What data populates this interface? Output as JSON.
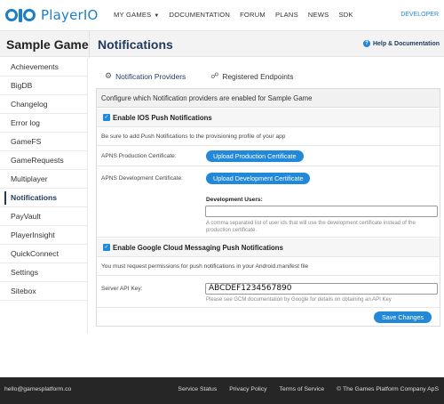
{
  "brand": {
    "name": "PlayerIO"
  },
  "nav": {
    "links": [
      "MY GAMES",
      "DOCUMENTATION",
      "FORUM",
      "PLANS",
      "NEWS",
      "SDK"
    ],
    "developer": "DEVELOPER"
  },
  "header": {
    "game_title": "Sample Game",
    "page_title": "Notifications",
    "help": "Help & Documentation"
  },
  "sidebar": {
    "items": [
      "Achievements",
      "BigDB",
      "Changelog",
      "Error log",
      "GameFS",
      "GameRequests",
      "Multiplayer",
      "Notifications",
      "PayVault",
      "PlayerInsight",
      "QuickConnect",
      "Settings",
      "Sitebox"
    ],
    "active": "Notifications"
  },
  "tabs": {
    "providers": "Notification Providers",
    "endpoints": "Registered Endpoints"
  },
  "panel": {
    "heading": "Configure which Notification providers are enabled for Sample Game",
    "ios": {
      "checkbox_label": "Enable IOS Push Notifications",
      "note": "Be sure to add Push Notifications to the provisioning profile of your app",
      "prod_label": "APNS Production Certificate:",
      "prod_button": "Upload Production Certificate",
      "dev_label": "APNS Development Certificate:",
      "dev_button": "Upload Development Certificate",
      "dev_users_label": "Development Users:",
      "dev_users_value": "",
      "dev_users_help": "A comma separated list of user ids that will use the development certificate instead of the production certificate."
    },
    "gcm": {
      "checkbox_label": "Enable Google Cloud Messaging Push Notifications",
      "note": "You must request permissions for push notifications in your Android.manifest file",
      "api_key_label": "Server API Key:",
      "api_key_value": "ABCDEF1234567890",
      "api_key_help": "Please see GCM documentation by Google for details on obtaining an API Key"
    },
    "save": "Save Changes"
  },
  "footer": {
    "email": "hello@gamesplatform.co",
    "links": [
      "Service Status",
      "Privacy Policy",
      "Terms of Service",
      "© The Games Platform Company ApS"
    ]
  },
  "colors": {
    "accent": "#2288d8",
    "title": "#1f3a5c",
    "footer_bg": "#262626"
  }
}
